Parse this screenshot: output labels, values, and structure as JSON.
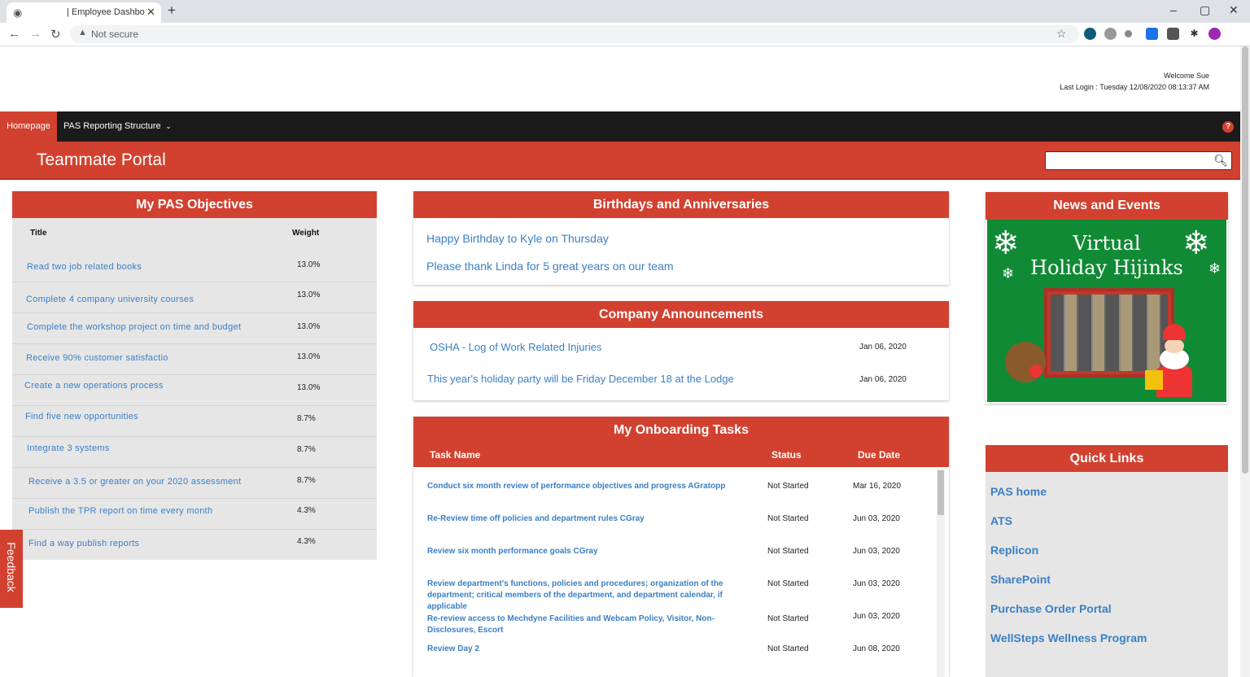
{
  "browser": {
    "tab_title": "| Employee Dashboard",
    "tab_close": "✕",
    "new_tab": "+",
    "address": "Not secure",
    "window_controls": [
      "–",
      "▢",
      "✕"
    ]
  },
  "header": {
    "welcome": "Welcome Sue",
    "last_login": "Last Login : Tuesday 12/08/2020 08:13:37 AM"
  },
  "nav": {
    "homepage": "Homepage",
    "pas": "PAS Reporting Structure",
    "help": "?"
  },
  "portal_title": "Teammate Portal",
  "objectives": {
    "title": "My PAS Objectives",
    "col_title": "Title",
    "col_weight": "Weight",
    "rows": [
      {
        "title": "Read two job related books",
        "weight": "13.0%"
      },
      {
        "title": "Complete 4 company university courses",
        "weight": "13.0%"
      },
      {
        "title": "Complete the workshop project on time and budget",
        "weight": "13.0%"
      },
      {
        "title": "Receive 90% customer satisfactio",
        "weight": "13.0%"
      },
      {
        "title": "Create a new operations process",
        "weight": "13.0%"
      },
      {
        "title": "Find five new opportunities",
        "weight": "8.7%"
      },
      {
        "title": "Integrate 3 systems",
        "weight": "8.7%"
      },
      {
        "title": "Receive a 3.5 or greater on your 2020 assessment",
        "weight": "8.7%"
      },
      {
        "title": "Publish the TPR report on time every month",
        "weight": "4.3%"
      },
      {
        "title": "Find a way publish reports",
        "weight": "4.3%"
      }
    ]
  },
  "birthdays": {
    "title": "Birthdays and Anniversaries",
    "items": [
      "Happy Birthday to Kyle on Thursday",
      "Please thank Linda for 5 great years on our team"
    ]
  },
  "announcements": {
    "title": "Company Announcements",
    "items": [
      {
        "text": "OSHA - Log of Work Related Injuries",
        "date": "Jan 06, 2020"
      },
      {
        "text": "This year's holiday party will be Friday December 18 at the Lodge",
        "date": "Jan 06, 2020"
      }
    ]
  },
  "onboarding": {
    "title": "My Onboarding Tasks",
    "col_task": "Task Name",
    "col_status": "Status",
    "col_due": "Due Date",
    "tasks": [
      {
        "name": "Conduct six month review of performance objectives and progress AGratopp",
        "status": "Not Started",
        "due": "Mar 16, 2020"
      },
      {
        "name": "Re-Review time off policies and department rules CGray",
        "status": "Not Started",
        "due": "Jun 03, 2020"
      },
      {
        "name": "Review six month performance goals CGray",
        "status": "Not Started",
        "due": "Jun 03, 2020"
      },
      {
        "name": "Review department's functions, policies and procedures; organization of the department; critical members of the department, and department calendar, if applicable",
        "status": "Not Started",
        "due": "Jun 03, 2020"
      },
      {
        "name": "Re-review access to Mechdyne Facilities and Webcam Policy, Visitor, Non-Disclosures, Escort",
        "status": "Not Started",
        "due": "Jun 03, 2020"
      },
      {
        "name": "Review Day 2",
        "status": "Not Started",
        "due": "Jun 08, 2020"
      }
    ]
  },
  "news": {
    "title": "News and Events",
    "banner_line1": "Virtual",
    "banner_line2": "Holiday Hijinks"
  },
  "quick_links": {
    "title": "Quick Links",
    "items": [
      "PAS home",
      "ATS",
      "Replicon",
      "SharePoint",
      "Purchase Order Portal",
      "WellSteps Wellness Program"
    ]
  },
  "feedback": "Feedback",
  "icons": {
    "search": "search-icon",
    "chevron": "chevron-down-icon",
    "help": "help-icon"
  }
}
